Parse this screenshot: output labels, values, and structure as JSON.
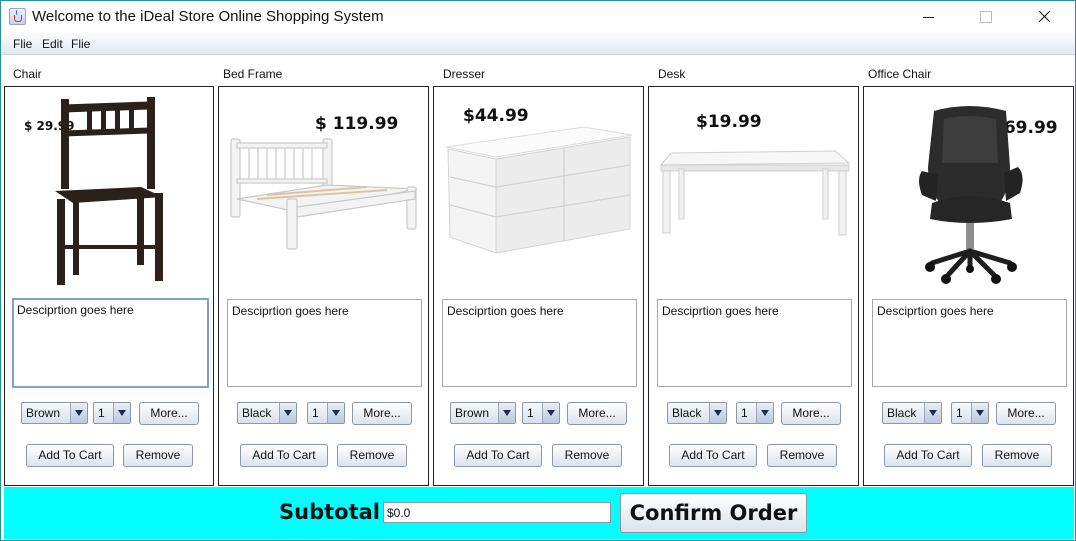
{
  "window": {
    "title": "Welcome to the iDeal Store Online Shopping System"
  },
  "menu": [
    "Flie",
    "Edit",
    "Flie"
  ],
  "products": [
    {
      "label": "Chair",
      "price": "$ 29.99",
      "description": "Desciprtion goes here",
      "color": "Brown",
      "quantity": "1",
      "more_label": "More...",
      "add_label": "Add To Cart",
      "remove_label": "Remove",
      "image": "chair-image"
    },
    {
      "label": "Bed Frame",
      "price": "$ 119.99",
      "description": "Desciprtion goes here",
      "color": "Black",
      "quantity": "1",
      "more_label": "More...",
      "add_label": "Add To Cart",
      "remove_label": "Remove",
      "image": "bed-frame-image"
    },
    {
      "label": "Dresser",
      "price": "$44.99",
      "description": "Desciprtion goes here",
      "color": "Brown",
      "quantity": "1",
      "more_label": "More...",
      "add_label": "Add To Cart",
      "remove_label": "Remove",
      "image": "dresser-image"
    },
    {
      "label": "Desk",
      "price": "$19.99",
      "description": "Desciprtion goes here",
      "color": "Black",
      "quantity": "1",
      "more_label": "More...",
      "add_label": "Add To Cart",
      "remove_label": "Remove",
      "image": "desk-image"
    },
    {
      "label": "Office Chair",
      "price": "$69.99",
      "description": "Desciprtion goes here",
      "color": "Black",
      "quantity": "1",
      "more_label": "More...",
      "add_label": "Add To Cart",
      "remove_label": "Remove",
      "image": "office-chair-image"
    }
  ],
  "footer": {
    "subtotal_label": "Subtotal",
    "subtotal_value": "$0.0",
    "confirm_label": "Confirm Order",
    "background_color": "#00ffff"
  }
}
